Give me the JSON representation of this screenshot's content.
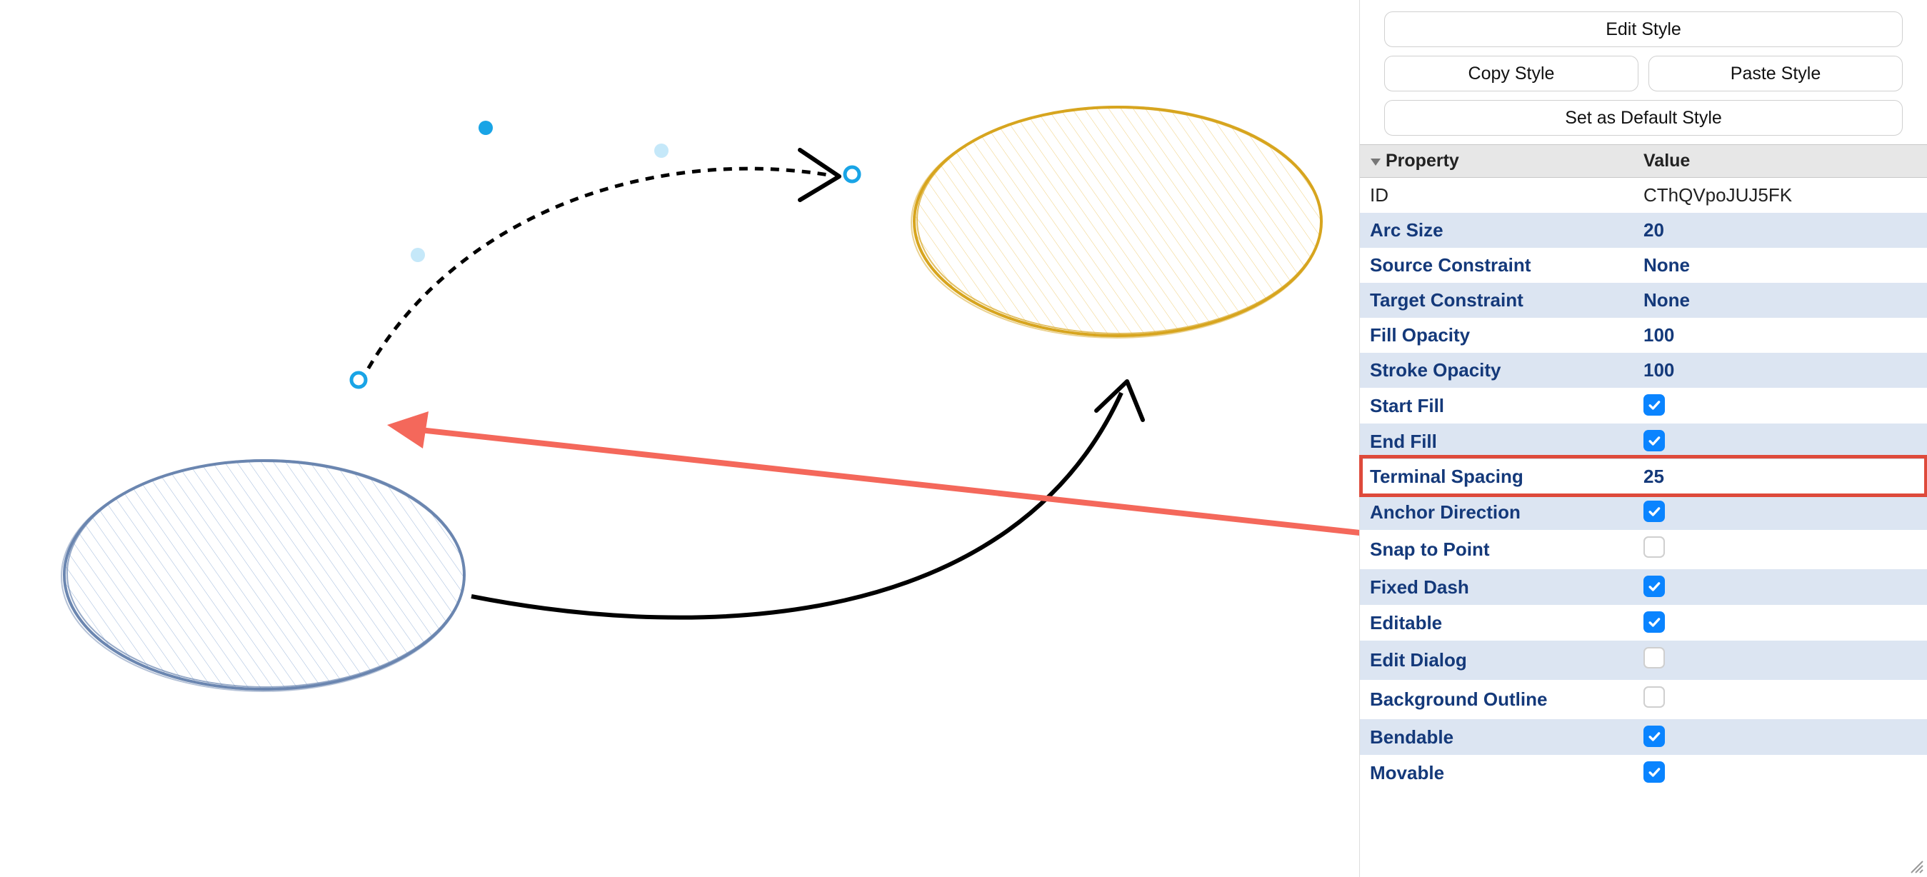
{
  "style_buttons": {
    "edit_style": "Edit Style",
    "copy_style": "Copy Style",
    "paste_style": "Paste Style",
    "default_style": "Set as Default Style"
  },
  "columns": {
    "property": "Property",
    "value": "Value"
  },
  "rows": [
    {
      "key": "id",
      "label": "ID",
      "value": "CThQVpoJUJ5FK",
      "type": "text-plain",
      "zebra": "odd",
      "interact": false
    },
    {
      "key": "arc_size",
      "label": "Arc Size",
      "value": "20",
      "type": "text",
      "zebra": "even",
      "interact": true
    },
    {
      "key": "source_constraint",
      "label": "Source Constraint",
      "value": "None",
      "type": "text",
      "zebra": "odd",
      "interact": true
    },
    {
      "key": "target_constraint",
      "label": "Target Constraint",
      "value": "None",
      "type": "text",
      "zebra": "even",
      "interact": true
    },
    {
      "key": "fill_opacity",
      "label": "Fill Opacity",
      "value": "100",
      "type": "text",
      "zebra": "odd",
      "interact": true
    },
    {
      "key": "stroke_opacity",
      "label": "Stroke Opacity",
      "value": "100",
      "type": "text",
      "zebra": "even",
      "interact": true
    },
    {
      "key": "start_fill",
      "label": "Start Fill",
      "value": true,
      "type": "bool",
      "zebra": "odd",
      "interact": true
    },
    {
      "key": "end_fill",
      "label": "End Fill",
      "value": true,
      "type": "bool",
      "zebra": "even",
      "interact": true
    },
    {
      "key": "terminal_spacing",
      "label": "Terminal Spacing",
      "value": "25",
      "type": "text",
      "zebra": "odd",
      "interact": true,
      "highlighted": true
    },
    {
      "key": "anchor_direction",
      "label": "Anchor Direction",
      "value": true,
      "type": "bool",
      "zebra": "even",
      "interact": true
    },
    {
      "key": "snap_to_point",
      "label": "Snap to Point",
      "value": false,
      "type": "bool",
      "zebra": "odd",
      "interact": true
    },
    {
      "key": "fixed_dash",
      "label": "Fixed Dash",
      "value": true,
      "type": "bool",
      "zebra": "even",
      "interact": true
    },
    {
      "key": "editable",
      "label": "Editable",
      "value": true,
      "type": "bool",
      "zebra": "odd",
      "interact": true
    },
    {
      "key": "edit_dialog",
      "label": "Edit Dialog",
      "value": false,
      "type": "bool",
      "zebra": "even",
      "interact": true
    },
    {
      "key": "background_outline",
      "label": "Background Outline",
      "value": false,
      "type": "bool",
      "zebra": "odd",
      "interact": true
    },
    {
      "key": "bendable",
      "label": "Bendable",
      "value": true,
      "type": "bool",
      "zebra": "even",
      "interact": true
    },
    {
      "key": "movable",
      "label": "Movable",
      "value": true,
      "type": "bool",
      "zebra": "odd",
      "interact": true
    }
  ],
  "highlight": {
    "row_key": "terminal_spacing"
  }
}
